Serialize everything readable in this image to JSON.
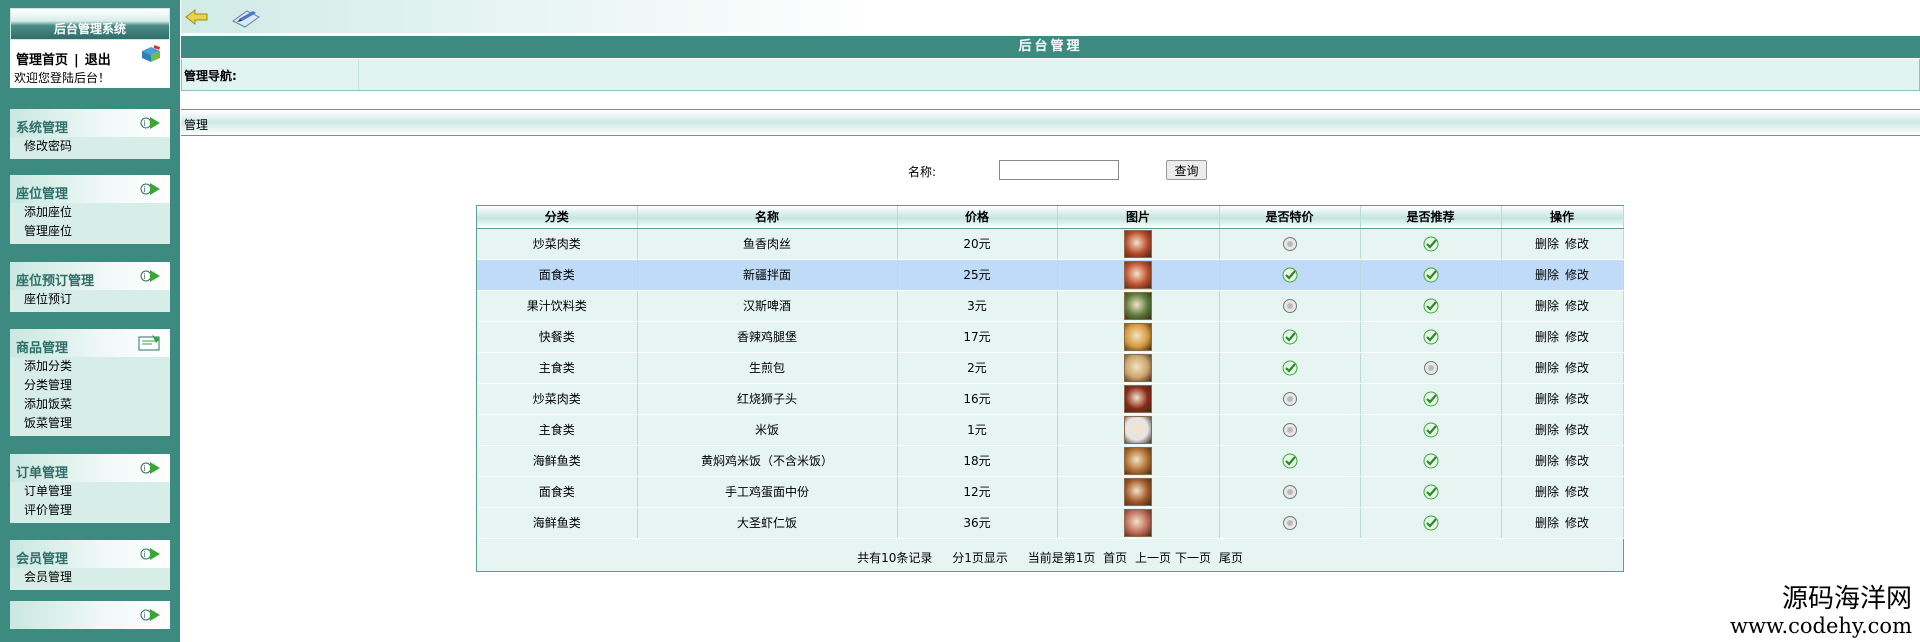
{
  "app": {
    "title": "后台管理系统"
  },
  "login": {
    "home_label": "管理首页",
    "sep": "|",
    "logout_label": "退出",
    "welcome": "欢迎您登陆后台！"
  },
  "menus": [
    {
      "title": "系统管理",
      "items": [
        "修改密码"
      ]
    },
    {
      "title": "座位管理",
      "items": [
        "添加座位",
        "管理座位"
      ]
    },
    {
      "title": "座位预订管理",
      "items": [
        "座位预订"
      ]
    },
    {
      "title": "商品管理",
      "items": [
        "添加分类",
        "分类管理",
        "添加饭菜",
        "饭菜管理"
      ]
    },
    {
      "title": "订单管理",
      "items": [
        "订单管理",
        "评价管理"
      ]
    },
    {
      "title": "会员管理",
      "items": [
        "会员管理"
      ]
    },
    {
      "title": "",
      "items": []
    }
  ],
  "main": {
    "panel_title": "后台管理",
    "nav_label": "管理导航:",
    "section_title": "管理",
    "search": {
      "label": "名称:",
      "value": "",
      "button": "查询"
    }
  },
  "table": {
    "headers": [
      "分类",
      "名称",
      "价格",
      "图片",
      "是否特价",
      "是否推荐",
      "操作"
    ],
    "delete_label": "删除",
    "edit_label": "修改",
    "rows": [
      {
        "category": "炒菜肉类",
        "name": "鱼香肉丝",
        "price": "20元",
        "special": false,
        "recommend": true,
        "img_color": "#b84a2a"
      },
      {
        "category": "面食类",
        "name": "新疆拌面",
        "price": "25元",
        "special": true,
        "recommend": true,
        "img_color": "#c0502e"
      },
      {
        "category": "果汁饮料类",
        "name": "汉斯啤酒",
        "price": "3元",
        "special": false,
        "recommend": true,
        "img_color": "#5a7a3a"
      },
      {
        "category": "快餐类",
        "name": "香辣鸡腿堡",
        "price": "17元",
        "special": true,
        "recommend": true,
        "img_color": "#d69a3c"
      },
      {
        "category": "主食类",
        "name": "生煎包",
        "price": "2元",
        "special": true,
        "recommend": false,
        "img_color": "#caa56a"
      },
      {
        "category": "炒菜肉类",
        "name": "红烧狮子头",
        "price": "16元",
        "special": false,
        "recommend": true,
        "img_color": "#8a2a1a"
      },
      {
        "category": "主食类",
        "name": "米饭",
        "price": "1元",
        "special": false,
        "recommend": true,
        "img_color": "#e6e6e6"
      },
      {
        "category": "海鲜鱼类",
        "name": "黄焖鸡米饭（不含米饭）",
        "price": "18元",
        "special": true,
        "recommend": true,
        "img_color": "#b07030"
      },
      {
        "category": "面食类",
        "name": "手工鸡蛋面中份",
        "price": "12元",
        "special": false,
        "recommend": true,
        "img_color": "#a35a2a"
      },
      {
        "category": "海鲜鱼类",
        "name": "大圣虾仁饭",
        "price": "36元",
        "special": false,
        "recommend": true,
        "img_color": "#c06a5a"
      }
    ],
    "highlight_row": 1,
    "pager": {
      "total": "共有10条记录",
      "pages": "分1页显示",
      "current": "当前是第1页",
      "first": "首页",
      "prev": "上一页",
      "next": "下一页",
      "last": "尾页"
    }
  },
  "watermark": {
    "line1": "源码海洋网",
    "line2": "www.codehy.com"
  },
  "colors": {
    "sidebar": "#3d8a80",
    "accent": "#3d8a80",
    "highlight": "#bfdbf7",
    "check_green": "#3aa63a"
  }
}
